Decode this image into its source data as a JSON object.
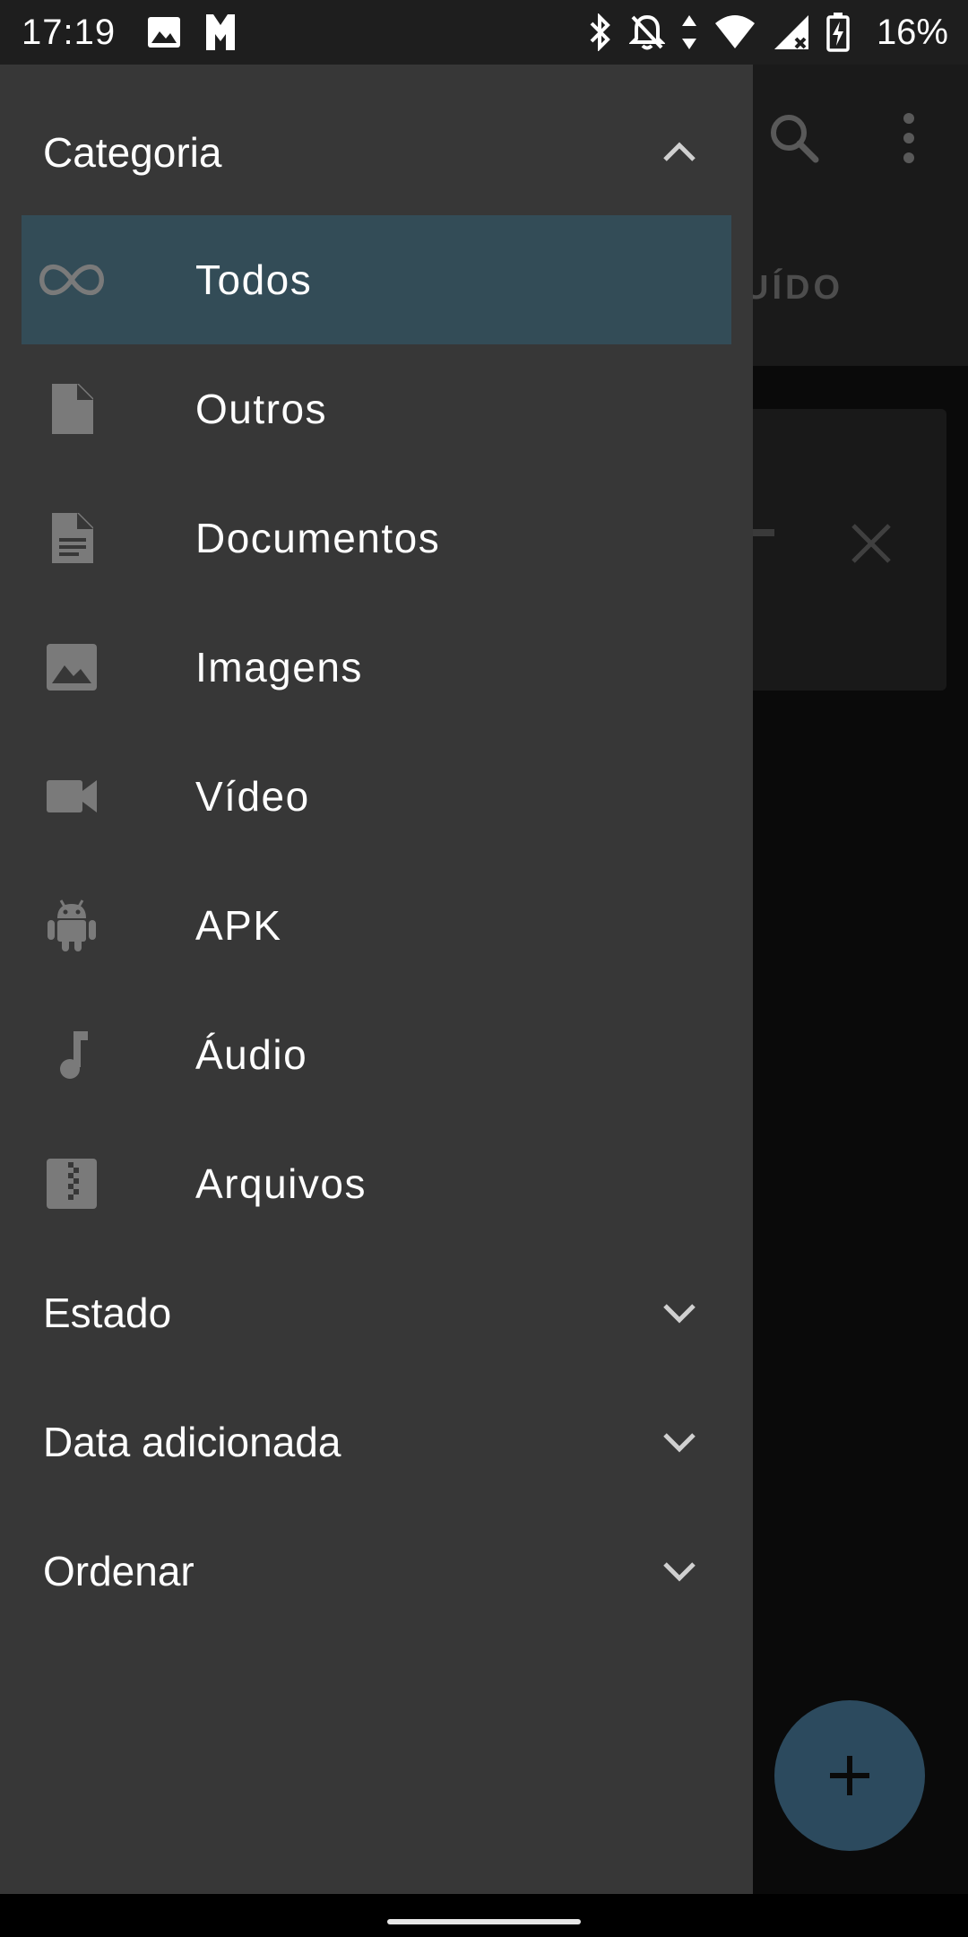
{
  "status_bar": {
    "time": "17:19",
    "battery_percent": "16%",
    "left_icons": [
      "image-icon",
      "app-notification-icon"
    ],
    "right_icons": [
      "bluetooth-icon",
      "notifications-off-icon",
      "data-arrows-icon",
      "wifi-icon",
      "signal-icon",
      "battery-charging-icon"
    ]
  },
  "background_app": {
    "tab_label_fragment": "UÍDO",
    "icons": [
      "search-icon",
      "more-vert-icon",
      "close-icon",
      "add-icon"
    ],
    "fab_color": "#2c4a5e"
  },
  "drawer": {
    "background_color": "#373737",
    "selected_color": "#334c57",
    "sections": {
      "categoria": {
        "title": "Categoria",
        "expanded": true
      },
      "estado": {
        "title": "Estado",
        "expanded": false
      },
      "data_adicionada": {
        "title": "Data adicionada",
        "expanded": false
      },
      "ordenar": {
        "title": "Ordenar",
        "expanded": false
      }
    },
    "categories": [
      {
        "label": "Todos",
        "icon": "infinity-icon",
        "selected": true
      },
      {
        "label": "Outros",
        "icon": "file-icon",
        "selected": false
      },
      {
        "label": "Documentos",
        "icon": "document-icon",
        "selected": false
      },
      {
        "label": "Imagens",
        "icon": "image-icon",
        "selected": false
      },
      {
        "label": "Vídeo",
        "icon": "videocam-icon",
        "selected": false
      },
      {
        "label": "APK",
        "icon": "android-icon",
        "selected": false
      },
      {
        "label": "Áudio",
        "icon": "music-note-icon",
        "selected": false
      },
      {
        "label": "Arquivos",
        "icon": "archive-icon",
        "selected": false
      }
    ]
  }
}
